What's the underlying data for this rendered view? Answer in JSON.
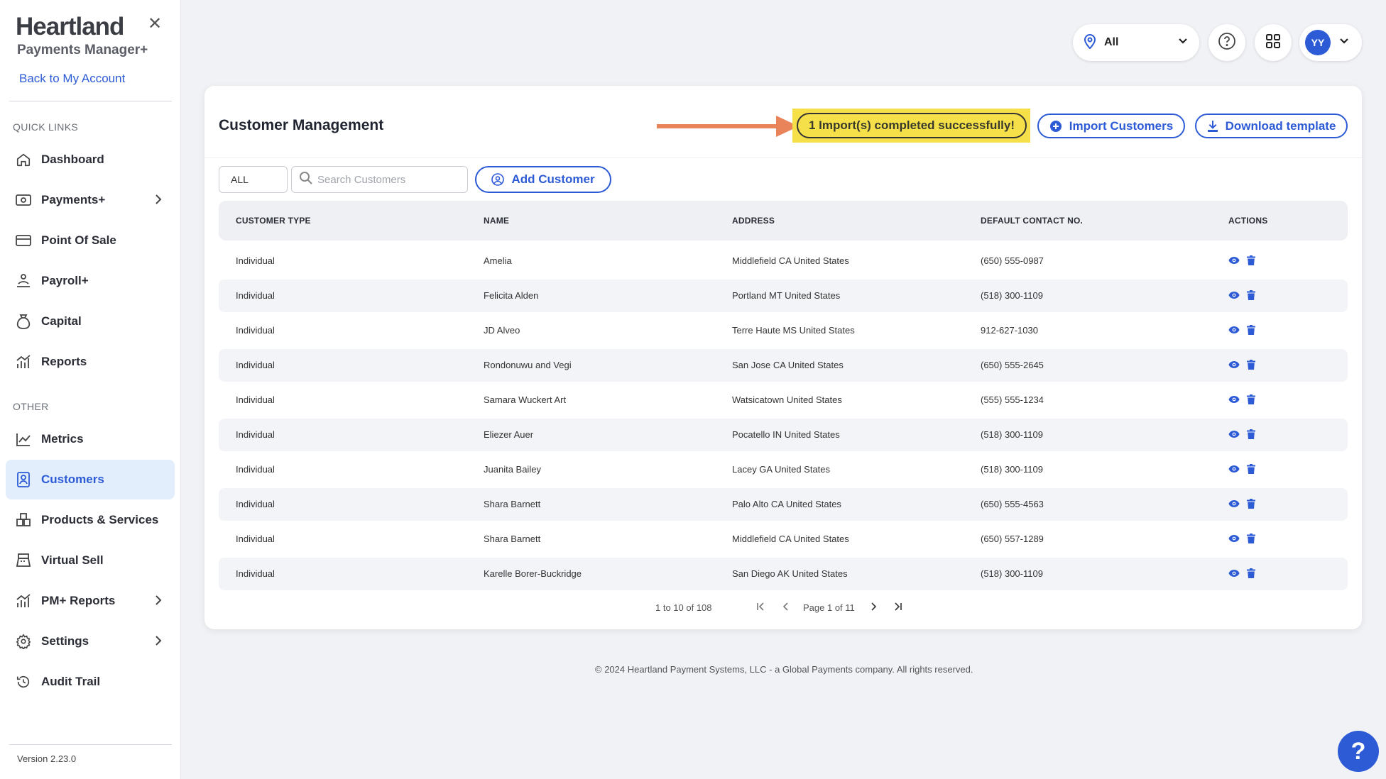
{
  "sidebar": {
    "brand": "Heartland",
    "brand_sub": "Payments Manager+",
    "close_glyph": "✕",
    "back_link": "Back to My Account",
    "quick_links_label": "QUICK LINKS",
    "other_label": "OTHER",
    "items": [
      {
        "label": "Dashboard",
        "icon": "home-icon"
      },
      {
        "label": "Payments+",
        "icon": "payments-icon",
        "has_submenu": true
      },
      {
        "label": "Point Of Sale",
        "icon": "card-icon"
      },
      {
        "label": "Payroll+",
        "icon": "payroll-icon"
      },
      {
        "label": "Capital",
        "icon": "money-bag-icon"
      },
      {
        "label": "Reports",
        "icon": "reports-icon"
      },
      {
        "label": "Metrics",
        "icon": "metrics-icon"
      },
      {
        "label": "Customers",
        "icon": "customers-icon",
        "active": true
      },
      {
        "label": "Products & Services",
        "icon": "products-icon"
      },
      {
        "label": "Virtual Sell",
        "icon": "register-icon"
      },
      {
        "label": "PM+ Reports",
        "icon": "reports-icon",
        "has_submenu": true
      },
      {
        "label": "Settings",
        "icon": "gear-icon",
        "has_submenu": true
      },
      {
        "label": "Audit Trail",
        "icon": "history-icon"
      }
    ],
    "version": "Version 2.23.0"
  },
  "topbar": {
    "location_value": "All",
    "user_initials": "YY"
  },
  "card": {
    "title": "Customer Management",
    "success_message": "1 Import(s) completed successfully!",
    "import_button": "Import Customers",
    "download_button": "Download template",
    "filter_value": "ALL",
    "search_placeholder": "Search Customers",
    "add_button": "Add Customer"
  },
  "table": {
    "headers": [
      "CUSTOMER TYPE",
      "NAME",
      "ADDRESS",
      "DEFAULT CONTACT NO.",
      "ACTIONS"
    ],
    "rows": [
      [
        "Individual",
        "Amelia",
        "Middlefield CA United States",
        "(650) 555-0987"
      ],
      [
        "Individual",
        "Felicita Alden",
        "Portland MT United States",
        "(518) 300-1109"
      ],
      [
        "Individual",
        "JD Alveo",
        "Terre Haute MS United States",
        "912-627-1030"
      ],
      [
        "Individual",
        "Rondonuwu and Vegi",
        "San Jose CA United States",
        "(650) 555-2645"
      ],
      [
        "Individual",
        "Samara Wuckert Art",
        "Watsicatown United States",
        "(555) 555-1234"
      ],
      [
        "Individual",
        "Eliezer Auer",
        "Pocatello IN United States",
        "(518) 300-1109"
      ],
      [
        "Individual",
        "Juanita Bailey",
        "Lacey GA United States",
        "(518) 300-1109"
      ],
      [
        "Individual",
        "Shara Barnett",
        "Palo Alto CA United States",
        "(650) 555-4563"
      ],
      [
        "Individual",
        "Shara Barnett",
        "Middlefield CA United States",
        "(650) 557-1289"
      ],
      [
        "Individual",
        "Karelle Borer-Buckridge",
        "San Diego AK United States",
        "(518) 300-1109"
      ]
    ]
  },
  "pagination": {
    "range": "1 to 10 of 108",
    "page": "Page 1 of 11"
  },
  "footer": "© 2024 Heartland Payment Systems, LLC - a Global Payments company. All rights reserved.",
  "help_fab": "?",
  "colors": {
    "accent": "#2d5bd6",
    "highlight": "#f5e04a",
    "arrow": "#e8835a",
    "active_nav_bg": "#e2eefb"
  }
}
